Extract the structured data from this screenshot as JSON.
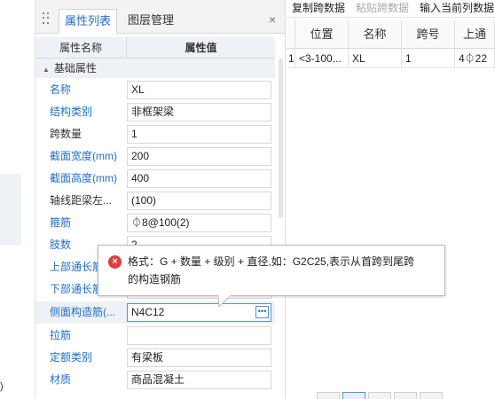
{
  "tabs": {
    "active": "属性列表",
    "inactive": "图层管理",
    "close": "×"
  },
  "grid_header": {
    "name": "属性名称",
    "value": "属性值"
  },
  "group": {
    "label": "基础属性"
  },
  "rows": [
    {
      "label": "名称",
      "value": "XL"
    },
    {
      "label": "结构类别",
      "value": "非框架梁"
    },
    {
      "label": "跨数量",
      "value": "1"
    },
    {
      "label": "截面宽度(mm)",
      "value": "200"
    },
    {
      "label": "截面高度(mm)",
      "value": "400"
    },
    {
      "label": "轴线距梁左...",
      "value": "(100)"
    },
    {
      "label": "箍筋",
      "value": "⏀8@100(2)"
    },
    {
      "label": "肢数",
      "value": "2"
    },
    {
      "label": "上部通长筋",
      "value": ""
    },
    {
      "label": "下部通长筋",
      "value": ""
    },
    {
      "label": "侧面构造筋(...",
      "value": "N4C12"
    },
    {
      "label": "拉筋",
      "value": ""
    },
    {
      "label": "定额类别",
      "value": "有梁板"
    },
    {
      "label": "材质",
      "value": "商品混凝土"
    }
  ],
  "tooltip": {
    "line1": "格式：G + 数量 + 级别 + 直径,如：G2C25,表示从首跨到尾跨",
    "line2": "的构造钢筋"
  },
  "toolbar": {
    "copy": "复制跨数据",
    "paste": "粘贴跨数据",
    "input": "输入当前列数据"
  },
  "table": {
    "headers": [
      "",
      "位置",
      "名称",
      "跨号",
      "上通"
    ],
    "row": [
      "1",
      "<3-100...",
      "XL",
      "1",
      "4⏀22"
    ]
  },
  "left": {
    "paren": ")"
  },
  "colors": {
    "accent": "#1c6fd1",
    "error": "#e23b3b"
  }
}
